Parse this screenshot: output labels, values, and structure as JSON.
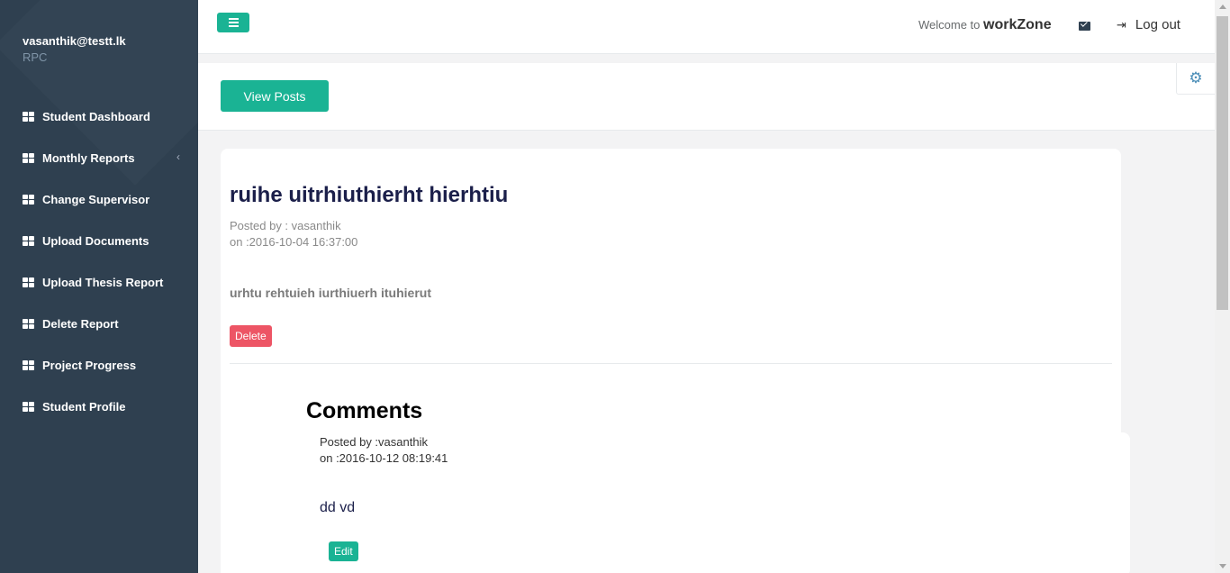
{
  "sidebar": {
    "user_email": "vasanthik@testt.lk",
    "user_role": "RPC",
    "items": [
      {
        "label": "Student Dashboard",
        "icon": "grid-icon"
      },
      {
        "label": "Monthly Reports",
        "icon": "grid-icon",
        "has_submenu": true
      },
      {
        "label": "Change Supervisor",
        "icon": "grid-icon"
      },
      {
        "label": "Upload Documents",
        "icon": "grid-icon"
      },
      {
        "label": "Upload Thesis Report",
        "icon": "grid-icon"
      },
      {
        "label": "Delete Report",
        "icon": "grid-icon"
      },
      {
        "label": "Project Progress",
        "icon": "grid-icon"
      },
      {
        "label": "Student Profile",
        "icon": "grid-icon"
      }
    ]
  },
  "topbar": {
    "welcome_text": "Welcome to",
    "brand": "workZone",
    "logout_label": "Log out"
  },
  "header": {
    "view_posts_label": "View Posts"
  },
  "post": {
    "title": "ruihe uitrhiuthierht hierhtiu",
    "posted_by": "Posted by : vasanthik",
    "posted_on": "on :2016-10-04 16:37:00",
    "body": "urhtu rehtuieh iurthiuerh ituhierut",
    "delete_label": "Delete"
  },
  "comments": {
    "title": "Comments",
    "items": [
      {
        "posted_by": "Posted by :vasanthik",
        "posted_on": "on :2016-10-12 08:19:41",
        "text": "dd vd",
        "edit_label": "Edit"
      }
    ]
  },
  "colors": {
    "sidebar_bg": "#2f4050",
    "primary": "#1ab394",
    "danger": "#ed5565",
    "title": "#1b1f4a"
  }
}
